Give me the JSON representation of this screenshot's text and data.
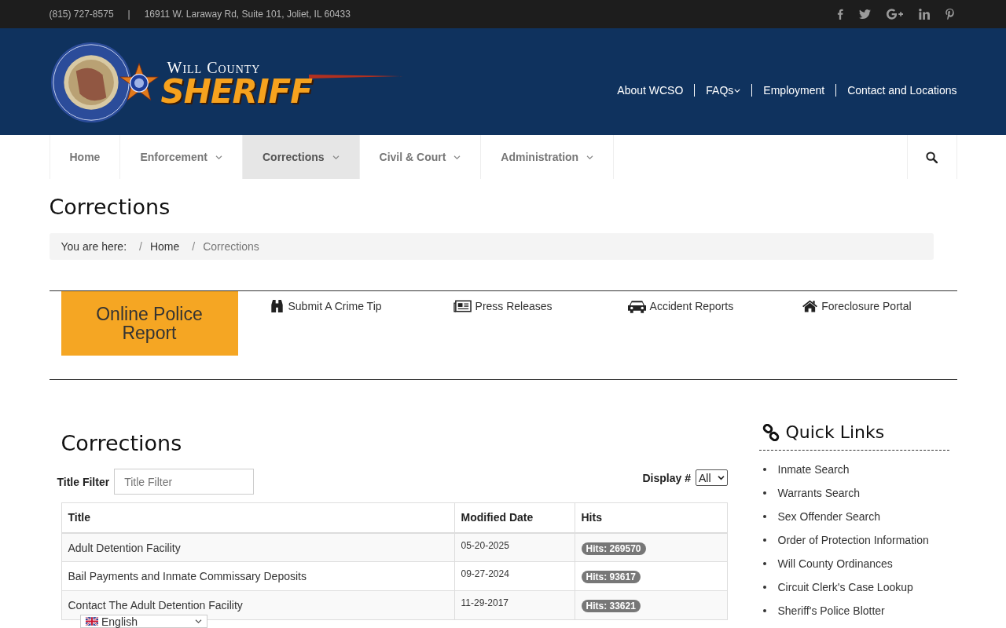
{
  "top_bar": {
    "phone": "(815) 727-8575",
    "separator": "|",
    "address": "16911 W. Laraway Rd, Suite 101, Joliet, IL 60433",
    "social": [
      {
        "kind": "facebook"
      },
      {
        "kind": "twitter"
      },
      {
        "kind": "googleplus"
      },
      {
        "kind": "linkedin"
      },
      {
        "kind": "pinterest"
      }
    ]
  },
  "logo": {
    "line1": "Will County",
    "line2": "SHERIFF"
  },
  "header_menu": [
    {
      "label": "About WCSO",
      "dropdown": false
    },
    {
      "label": "FAQs",
      "dropdown": true
    },
    {
      "label": "Employment",
      "dropdown": false
    },
    {
      "label": "Contact and Locations",
      "dropdown": false
    }
  ],
  "main_nav": [
    {
      "label": "Home",
      "dropdown": false,
      "selected": false
    },
    {
      "label": "Enforcement",
      "dropdown": true,
      "selected": false
    },
    {
      "label": "Corrections",
      "dropdown": true,
      "selected": true
    },
    {
      "label": "Civil & Court",
      "dropdown": true,
      "selected": false
    },
    {
      "label": "Administration",
      "dropdown": true,
      "selected": false
    }
  ],
  "page_title": "Corrections",
  "breadcrumb": {
    "prefix": "You are here:",
    "divider": "/",
    "items": [
      {
        "label": "Home",
        "current": false
      },
      {
        "label": "Corrections",
        "current": true
      }
    ]
  },
  "featured": {
    "button": "Online Police Report",
    "links": [
      {
        "kind": "binoculars",
        "label": "Submit A Crime Tip"
      },
      {
        "kind": "newspaper",
        "label": "Press Releases"
      },
      {
        "kind": "car",
        "label": "Accident Reports"
      },
      {
        "kind": "home",
        "label": "Foreclosure Portal"
      }
    ]
  },
  "category": {
    "title": "Corrections",
    "filter_label": "Title Filter",
    "filter_placeholder": "Title Filter",
    "display_label": "Display #",
    "display_value": "All",
    "columns": [
      "Title",
      "Modified Date",
      "Hits"
    ],
    "rows": [
      {
        "title": "Adult Detention Facility",
        "date": "05-20-2025",
        "hits": "Hits: 269570"
      },
      {
        "title": "Bail Payments and Inmate Commissary Deposits",
        "date": "09-27-2024",
        "hits": "Hits: 93617"
      },
      {
        "title": "Contact The Adult Detention Facility",
        "date": "11-29-2017",
        "hits": "Hits: 33621"
      }
    ]
  },
  "quick_links": {
    "title": "Quick Links",
    "items": [
      "Inmate Search",
      "Warrants Search",
      "Sex Offender Search",
      "Order of Protection Information",
      "Will County Ordinances",
      "Circuit Clerk's Case Lookup",
      "Sheriff's Police Blotter"
    ]
  },
  "language_widget": {
    "label": "English"
  }
}
